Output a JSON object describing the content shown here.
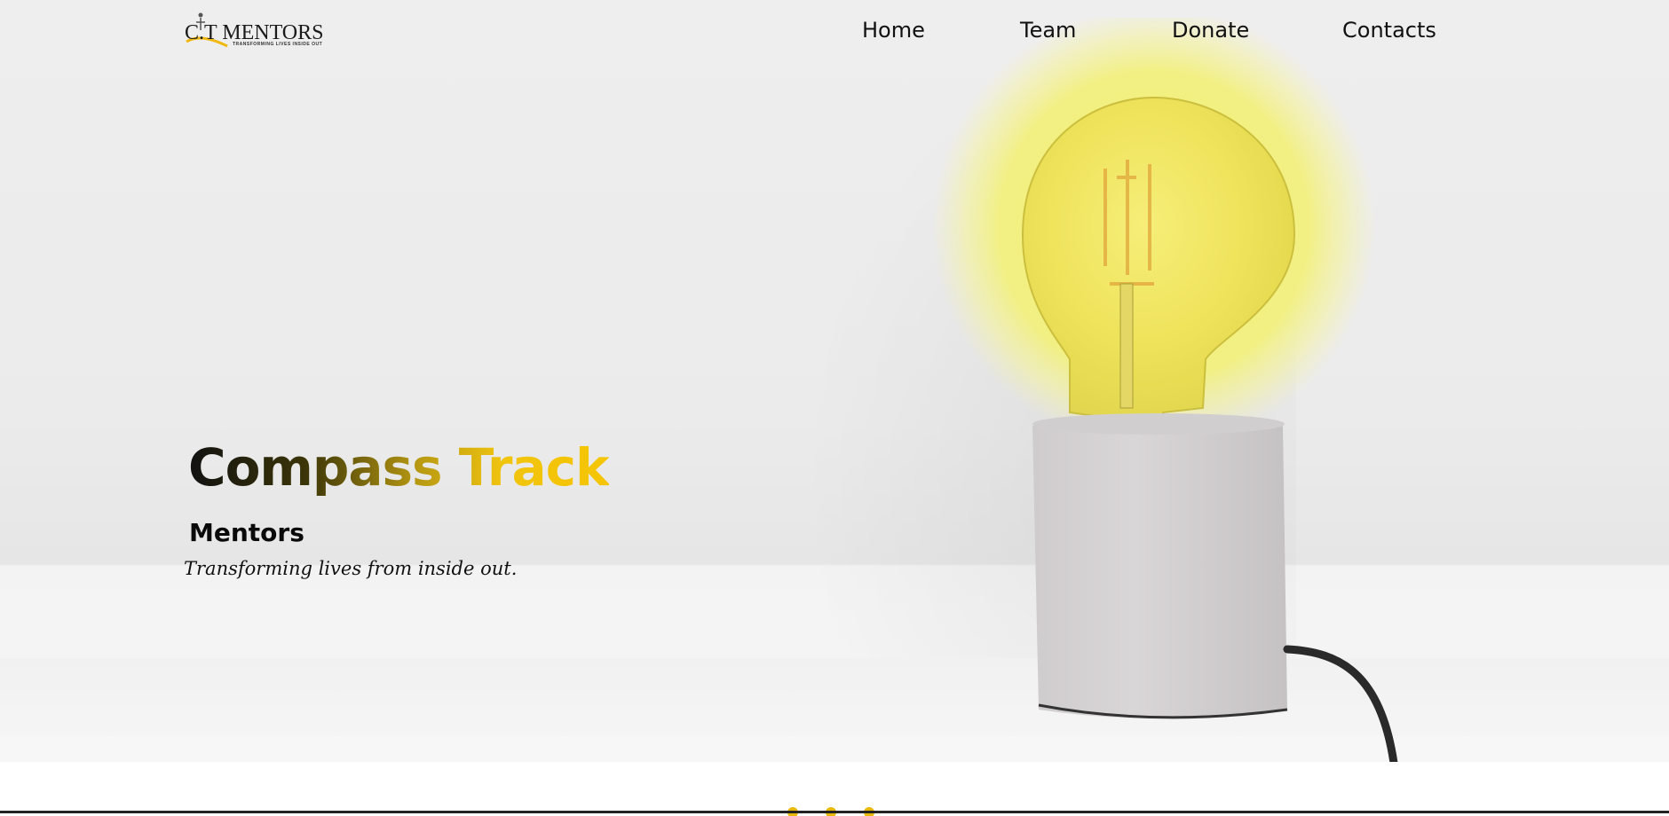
{
  "header": {
    "logo": {
      "text": "C.T MENTORS",
      "tagline": "TRANSFORMING LIVES INSIDE OUT"
    },
    "nav": [
      {
        "label": "Home"
      },
      {
        "label": "Team"
      },
      {
        "label": "Donate"
      },
      {
        "label": "Contacts"
      }
    ]
  },
  "hero": {
    "title": "Compass Track",
    "subtitle": "Mentors",
    "tagline": "Transforming lives from inside out."
  },
  "colors": {
    "accent": "#f1c40f",
    "glow": "#f4f27a",
    "text": "#111111"
  }
}
